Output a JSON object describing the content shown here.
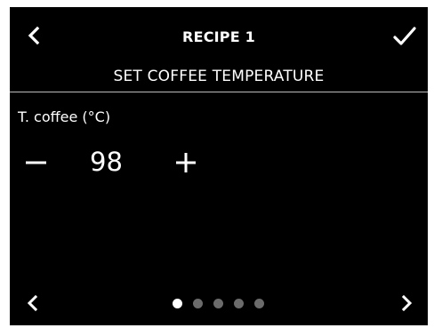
{
  "header": {
    "title": "RECIPE 1",
    "back_icon": "chevron-left-icon",
    "confirm_icon": "checkmark-icon"
  },
  "section": {
    "subtitle": "SET COFFEE TEMPERATURE"
  },
  "setting": {
    "label": "T. coffee (°C)",
    "value": "98",
    "decrement_icon": "minus-icon",
    "increment_icon": "plus-icon"
  },
  "footer": {
    "prev_icon": "chevron-left-icon",
    "next_icon": "chevron-right-icon",
    "page_count": 5,
    "active_page": 1
  },
  "colors": {
    "background": "#000000",
    "foreground": "#ffffff",
    "inactive_dot": "#6b6b6b"
  }
}
